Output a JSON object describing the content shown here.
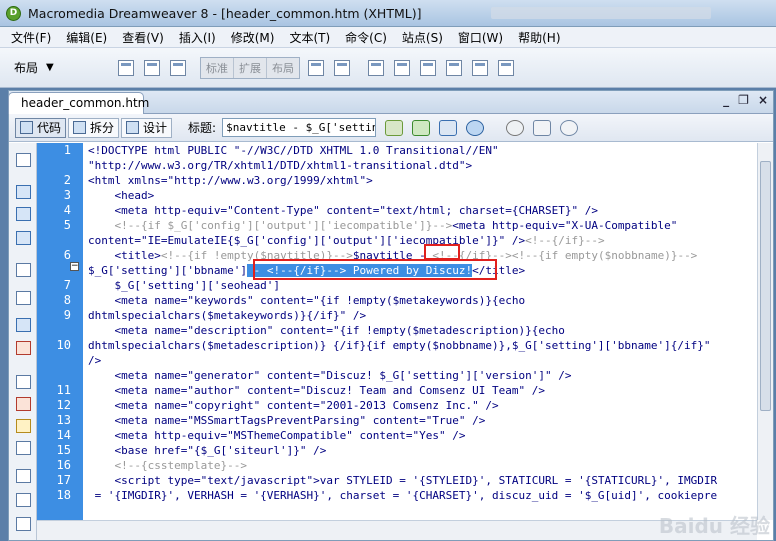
{
  "window": {
    "title": "Macromedia Dreamweaver 8 - [header_common.htm (XHTML)]"
  },
  "menu": [
    "文件(F)",
    "编辑(E)",
    "查看(V)",
    "插入(I)",
    "修改(M)",
    "文本(T)",
    "命令(C)",
    "站点(S)",
    "窗口(W)",
    "帮助(H)"
  ],
  "toolbar": {
    "layout_label": "布局",
    "seg_buttons": [
      "标准",
      "扩展",
      "布局"
    ]
  },
  "document": {
    "tab_label": "header_common.htm",
    "win_controls": [
      "_",
      "❐",
      "×"
    ],
    "view_buttons": [
      "代码",
      "拆分",
      "设计"
    ],
    "title_label": "标题:",
    "title_value": "$navtitle - $_G['setting"
  },
  "code": {
    "gutter_numbers": [
      "1",
      "2",
      "3",
      "4",
      "5",
      "6",
      "7",
      "8",
      "9",
      "10",
      "11",
      "12",
      "13",
      "14",
      "15",
      "16",
      "17",
      "18"
    ],
    "lines": [
      {
        "parts": [
          {
            "t": "tag",
            "v": "<!DOCTYPE html PUBLIC \"-//W3C//DTD XHTML 1.0 Transitional//EN\""
          }
        ]
      },
      {
        "parts": [
          {
            "t": "tag",
            "v": "\"http://www.w3.org/TR/xhtml1/DTD/xhtml1-transitional.dtd\">"
          }
        ]
      },
      {
        "parts": [
          {
            "t": "tag",
            "v": "<html xmlns=\"http://www.w3.org/1999/xhtml\">"
          }
        ]
      },
      {
        "parts": [
          {
            "t": "tag",
            "v": "    <head>"
          }
        ]
      },
      {
        "parts": [
          {
            "t": "tag",
            "v": "    <meta http-equiv=\"Content-Type\" content=\"text/html; charset={CHARSET}\" />"
          }
        ]
      },
      {
        "parts": [
          {
            "t": "cm",
            "v": "    <!--{if $_G['config']['output']['iecompatible']}-->"
          },
          {
            "t": "tag",
            "v": "<meta http-equiv=\"X-UA-Compatible\""
          }
        ]
      },
      {
        "parts": [
          {
            "t": "tag",
            "v": "content=\"IE=EmulateIE{$_G['config']['output']['iecompatible']}\" />"
          },
          {
            "t": "cm",
            "v": "<!--{/if}-->"
          }
        ]
      },
      {
        "parts": [
          {
            "t": "tag",
            "v": "    <title>"
          },
          {
            "t": "cm",
            "v": "<!--{if !empty($navtitle)}-->"
          },
          {
            "t": "tag",
            "v": "$navtitle - "
          },
          {
            "t": "cm",
            "v": "<!--{/if}--><!--{if empty($nobbname)}-->"
          }
        ]
      },
      {
        "parts": [
          {
            "t": "tag",
            "v": "$_G['setting']['bbname']"
          },
          {
            "t": "hl",
            "v": " - <!--{/if}--> Powered by Discuz!"
          },
          {
            "t": "tag",
            "v": "</title>"
          }
        ]
      },
      {
        "parts": [
          {
            "t": "tag",
            "v": "    $_G['setting']['seohead']"
          }
        ]
      },
      {
        "parts": [
          {
            "t": "tag",
            "v": "    <meta name=\"keywords\" content=\"{if !empty($metakeywords)}{echo"
          }
        ]
      },
      {
        "parts": [
          {
            "t": "tag",
            "v": "dhtmlspecialchars($metakeywords)}{/if}\" />"
          }
        ]
      },
      {
        "parts": [
          {
            "t": "tag",
            "v": "    <meta name=\"description\" content=\"{if !empty($metadescription)}{echo"
          }
        ]
      },
      {
        "parts": [
          {
            "t": "tag",
            "v": "dhtmlspecialchars($metadescription)} {/if}{if empty($nobbname)},$_G['setting']['bbname']{/if}\""
          }
        ]
      },
      {
        "parts": [
          {
            "t": "tag",
            "v": "/>"
          }
        ]
      },
      {
        "parts": [
          {
            "t": "tag",
            "v": "    <meta name=\"generator\" content=\"Discuz! $_G['setting']['version']\" />"
          }
        ]
      },
      {
        "parts": [
          {
            "t": "tag",
            "v": "    <meta name=\"author\" content=\"Discuz! Team and Comsenz UI Team\" />"
          }
        ]
      },
      {
        "parts": [
          {
            "t": "tag",
            "v": "    <meta name=\"copyright\" content=\"2001-2013 Comsenz Inc.\" />"
          }
        ]
      },
      {
        "parts": [
          {
            "t": "tag",
            "v": "    <meta name=\"MSSmartTagsPreventParsing\" content=\"True\" />"
          }
        ]
      },
      {
        "parts": [
          {
            "t": "tag",
            "v": "    <meta http-equiv=\"MSThemeCompatible\" content=\"Yes\" />"
          }
        ]
      },
      {
        "parts": [
          {
            "t": "tag",
            "v": "    <base href=\"{$_G['siteurl']}\" />"
          }
        ]
      },
      {
        "parts": [
          {
            "t": "cm",
            "v": "    <!--{csstemplate}-->"
          }
        ]
      },
      {
        "parts": [
          {
            "t": "tag",
            "v": "    <script type=\"text/javascript\">var STYLEID = '{STYLEID}', STATICURL = '{STATICURL}', IMGDIR"
          }
        ]
      },
      {
        "parts": [
          {
            "t": "tag",
            "v": " = '{IMGDIR}', VERHASH = '{VERHASH}', charset = '{CHARSET}', discuz_uid = '$_G[uid]', cookiepre"
          }
        ]
      }
    ]
  },
  "watermark": "Baidu 经验"
}
